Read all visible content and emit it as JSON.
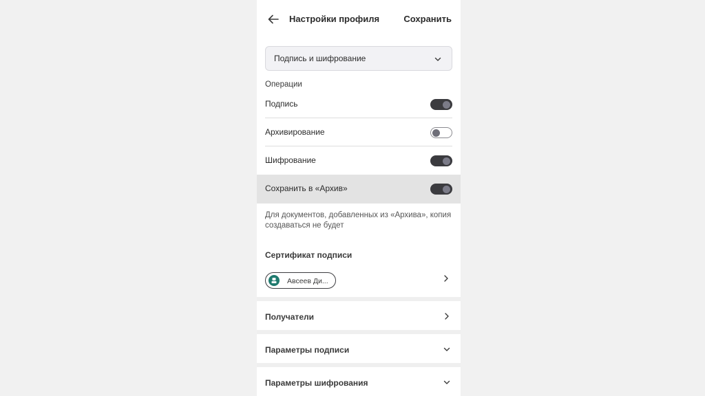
{
  "header": {
    "title": "Настройки профиля",
    "save_label": "Сохранить"
  },
  "profile_select": {
    "value": "Подпись и шифрование"
  },
  "operations": {
    "section_label": "Операции",
    "items": [
      {
        "label": "Подпись",
        "enabled": true
      },
      {
        "label": "Архивирование",
        "enabled": false
      },
      {
        "label": "Шифрование",
        "enabled": true
      },
      {
        "label": "Сохранить в «Архив»",
        "enabled": true
      }
    ],
    "hint": "Для документов, добавленных из «Архива», копия создаваться не будет"
  },
  "certificate": {
    "title": "Сертификат подписи",
    "chip_label": "Авсеев Ди..."
  },
  "sections": [
    {
      "label": "Получатели",
      "icon": "chevron-right-icon"
    },
    {
      "label": "Параметры подписи",
      "icon": "chevron-down-icon"
    },
    {
      "label": "Параметры шифрования",
      "icon": "chevron-down-icon"
    }
  ],
  "colors": {
    "accent_dark": "#3b3b3f",
    "avatar": "#1f7a6e",
    "highlight_row": "#e3e3e3"
  }
}
